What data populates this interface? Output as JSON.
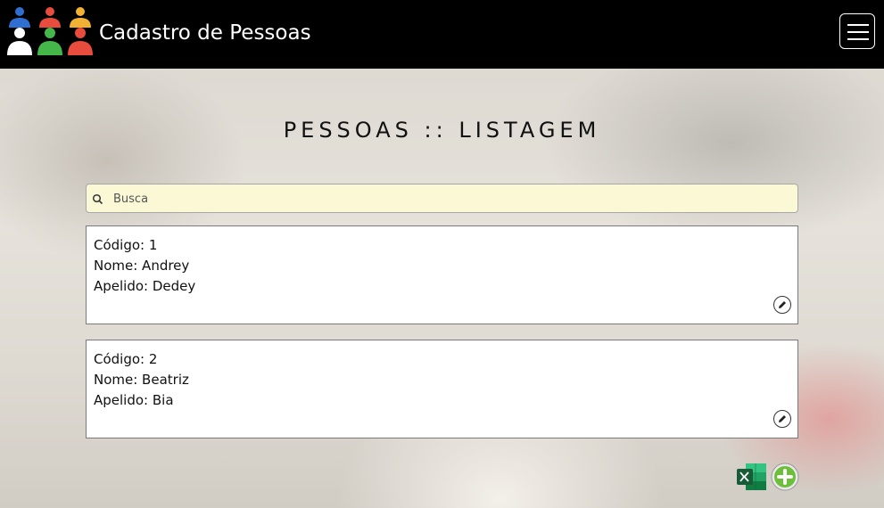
{
  "navbar": {
    "brand": "Cadastro de Pessoas",
    "logo_icon": "people-group-icon",
    "menu_icon": "hamburger-menu-icon"
  },
  "page": {
    "title": "PESSOAS :: LISTAGEM"
  },
  "search": {
    "placeholder": "Busca",
    "value": ""
  },
  "people": [
    {
      "codigo": "Código: 1",
      "nome": "Nome: Andrey",
      "apelido": "Apelido: Dedey"
    },
    {
      "codigo": "Código: 2",
      "nome": "Nome: Beatriz",
      "apelido": "Apelido: Bia"
    }
  ],
  "actions": {
    "export_icon": "excel-icon",
    "add_icon": "add-circle-icon"
  },
  "colors": {
    "navbar": "#000000",
    "search_background": "#fbf8d6",
    "add_green": "#6dbf3a",
    "excel_green": "#1d6f42"
  }
}
